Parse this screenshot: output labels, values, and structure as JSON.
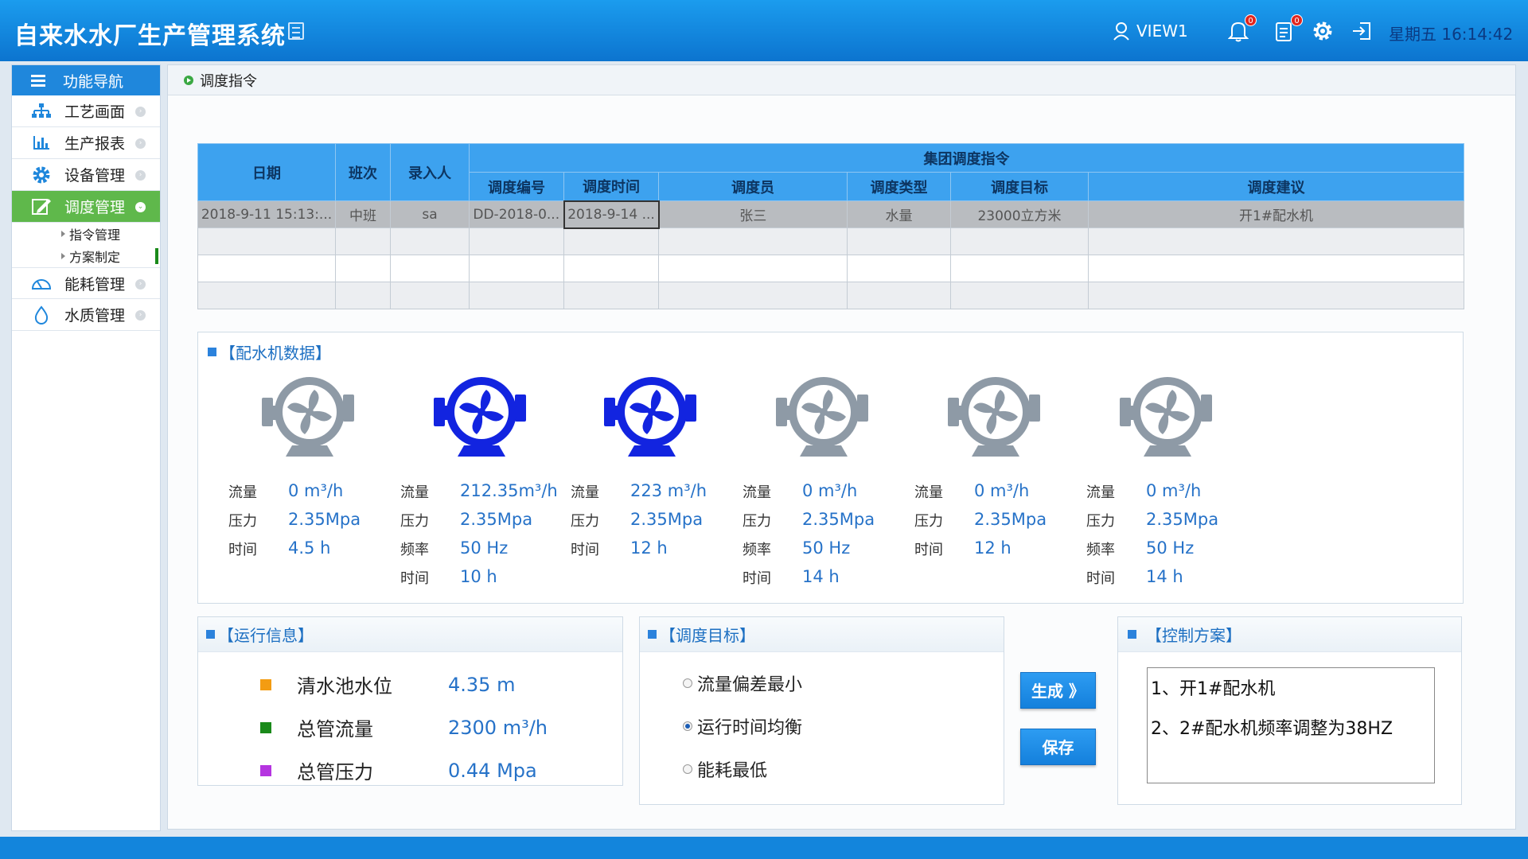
{
  "header": {
    "title": "自来水水厂生产管理系统",
    "user": "VIEW1",
    "alarm_badge": "0",
    "msg_badge": "0",
    "weekday": "星期五",
    "time": "16:14:42"
  },
  "sidebar": {
    "head": "功能导航",
    "items": [
      {
        "label": "工艺画面",
        "icon": "process-icon"
      },
      {
        "label": "生产报表",
        "icon": "bar-chart-icon"
      },
      {
        "label": "设备管理",
        "icon": "gear-icon"
      },
      {
        "label": "调度管理",
        "icon": "edit-icon"
      },
      {
        "label": "能耗管理",
        "icon": "gauge-icon"
      },
      {
        "label": "水质管理",
        "icon": "water-drop-icon"
      }
    ],
    "subitems": [
      "指令管理",
      "方案制定"
    ]
  },
  "breadcrumb": "调度指令",
  "table": {
    "group_header": "集团调度指令",
    "headers": [
      "日期",
      "班次",
      "录入人",
      "调度编号",
      "调度时间",
      "调度员",
      "调度类型",
      "调度目标",
      "调度建议"
    ],
    "rows": [
      [
        "2018-9-11 15:13:...",
        "中班",
        "sa",
        "DD-2018-0...",
        "2018-9-14 ...",
        "张三",
        "水量",
        "23000立方米",
        "开1#配水机"
      ],
      [
        "",
        "",
        "",
        "",
        "",
        "",
        "",
        "",
        ""
      ],
      [
        "",
        "",
        "",
        "",
        "",
        "",
        "",
        "",
        ""
      ],
      [
        "",
        "",
        "",
        "",
        "",
        "",
        "",
        "",
        ""
      ]
    ]
  },
  "pump_panel": {
    "title": "【配水机数据】",
    "pumps": [
      {
        "active": false,
        "rows": [
          [
            "流量",
            "0 m³/h"
          ],
          [
            "压力",
            "2.35Mpa"
          ],
          [
            "时间",
            "4.5  h"
          ]
        ]
      },
      {
        "active": true,
        "rows": [
          [
            "流量",
            "212.35m³/h"
          ],
          [
            "压力",
            "2.35Mpa"
          ],
          [
            "频率",
            "50 Hz"
          ],
          [
            "时间",
            "10  h"
          ]
        ]
      },
      {
        "active": true,
        "rows": [
          [
            "流量",
            "223  m³/h"
          ],
          [
            "压力",
            "2.35Mpa"
          ],
          [
            "时间",
            "12 h"
          ]
        ]
      },
      {
        "active": false,
        "rows": [
          [
            "流量",
            "0 m³/h"
          ],
          [
            "压力",
            "2.35Mpa"
          ],
          [
            "频率",
            "50 Hz"
          ],
          [
            "时间",
            "14  h"
          ]
        ]
      },
      {
        "active": false,
        "rows": [
          [
            "流量",
            "0 m³/h"
          ],
          [
            "压力",
            "2.35Mpa"
          ],
          [
            "时间",
            "12 h"
          ]
        ]
      },
      {
        "active": false,
        "rows": [
          [
            "流量",
            "0 m³/h"
          ],
          [
            "压力",
            "2.35Mpa"
          ],
          [
            "频率",
            "50 Hz"
          ],
          [
            "时间",
            "14  h"
          ]
        ]
      }
    ]
  },
  "run_info": {
    "title": "【运行信息】",
    "items": [
      {
        "label": "清水池水位",
        "value": "4.35  m",
        "color": "#f39c12"
      },
      {
        "label": "总管流量",
        "value": "2300 m³/h",
        "color": "#1a8a1a"
      },
      {
        "label": "总管压力",
        "value": "0.44 Mpa",
        "color": "#b535e0"
      }
    ]
  },
  "target": {
    "title": "【调度目标】",
    "options": [
      "流量偏差最小",
      "运行时间均衡",
      "能耗最低"
    ],
    "selected": 1
  },
  "buttons": {
    "generate": "生成 》",
    "save": "保存"
  },
  "plan": {
    "title": "【控制方案】",
    "lines": [
      "1、开1#配水机",
      "2、2#配水机频率调整为38HZ"
    ]
  },
  "colors": {
    "accent": "#1f87dc",
    "active_nav": "#5fb84b",
    "pump_active": "#1224e0",
    "pump_idle": "#8e9aa6"
  }
}
